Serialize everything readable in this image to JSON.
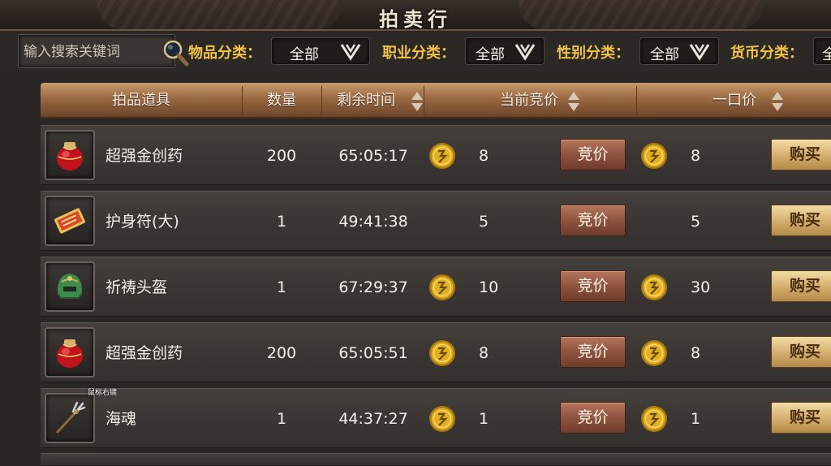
{
  "window": {
    "title": "拍卖行"
  },
  "search": {
    "placeholder": "输入搜索关键词"
  },
  "filters": [
    {
      "label": "物品分类：",
      "value": "全部"
    },
    {
      "label": "职业分类：",
      "value": "全部"
    },
    {
      "label": "性别分类：",
      "value": "全部"
    },
    {
      "label": "货币分类：",
      "value": "全"
    }
  ],
  "columns": {
    "item": "拍品道具",
    "quantity": "数量",
    "time_left": "剩余时间",
    "current_bid": "当前竞价",
    "buyout": "一口价"
  },
  "buttons": {
    "bid": "竞价",
    "buy": "购买"
  },
  "tooltip": "鼠标右键",
  "rows": [
    {
      "name": "超强金创药",
      "icon": "red-potion-jar-icon",
      "quantity": "200",
      "time_left": "65:05:17",
      "bid_coin": true,
      "bid": "8",
      "buy_coin": true,
      "buyout": "8"
    },
    {
      "name": "护身符(大)",
      "icon": "talisman-scroll-icon",
      "quantity": "1",
      "time_left": "49:41:38",
      "bid_coin": false,
      "bid": "5",
      "buy_coin": false,
      "buyout": "5"
    },
    {
      "name": "祈祷头盔",
      "icon": "green-helmet-icon",
      "quantity": "1",
      "time_left": "67:29:37",
      "bid_coin": true,
      "bid": "10",
      "buy_coin": true,
      "buyout": "30"
    },
    {
      "name": "超强金创药",
      "icon": "red-potion-jar-icon",
      "quantity": "200",
      "time_left": "65:05:51",
      "bid_coin": true,
      "bid": "8",
      "buy_coin": true,
      "buyout": "8"
    },
    {
      "name": "海魂",
      "icon": "trident-weapon-icon",
      "quantity": "1",
      "time_left": "44:37:27",
      "bid_coin": true,
      "bid": "1",
      "buy_coin": true,
      "buyout": "1"
    }
  ],
  "colors": {
    "filter_label": "#f0c24a",
    "header": "#9a6a43",
    "bid_button": "#8e5440",
    "buy_button": "#d6b070",
    "coin": "#e2b021"
  }
}
